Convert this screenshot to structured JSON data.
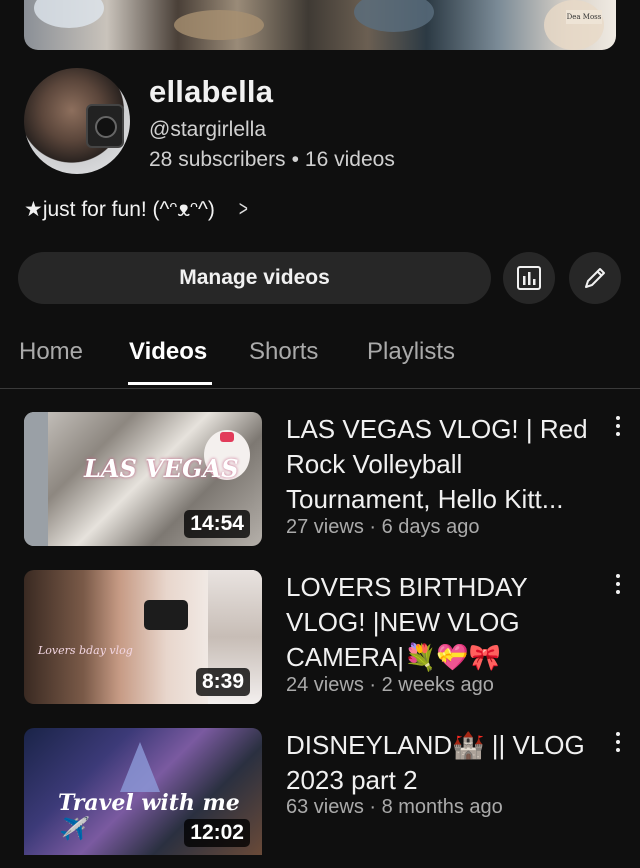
{
  "banner": {
    "tag_text": "Dea Moss"
  },
  "channel": {
    "name": "ellabella",
    "handle": "@stargirlella",
    "subscribers": "28 subscribers",
    "separator": "•",
    "videos_count": "16 videos",
    "description": "★just for fun! (^ᵔᴥᵔ^)"
  },
  "actions": {
    "manage_label": "Manage videos",
    "analytics_icon": "analytics-icon",
    "edit_icon": "pencil-icon"
  },
  "tabs": [
    {
      "label": "Home",
      "active": false
    },
    {
      "label": "Videos",
      "active": true
    },
    {
      "label": "Shorts",
      "active": false
    },
    {
      "label": "Playlists",
      "active": false
    }
  ],
  "videos": [
    {
      "title": "LAS VEGAS VLOG! | Red Rock Volleyball Tournament, Hello Kitt...",
      "meta": "27 views · 6 days ago",
      "duration": "14:54",
      "thumb_text": "LAS VEGAS"
    },
    {
      "title": "LOVERS BIRTHDAY VLOG! |NEW VLOG CAMERA|💐💝🎀",
      "meta": "24 views · 2 weeks ago",
      "duration": "8:39",
      "thumb_text": "Lovers bday vlog"
    },
    {
      "title": "DISNEYLAND🏰 || VLOG 2023 part 2",
      "meta": "63 views · 8 months ago",
      "duration": "12:02",
      "thumb_text": "Travel with me✈️"
    }
  ],
  "colors": {
    "background": "#0f0f0f",
    "button": "#272727",
    "text_secondary": "#aaaaaa"
  }
}
